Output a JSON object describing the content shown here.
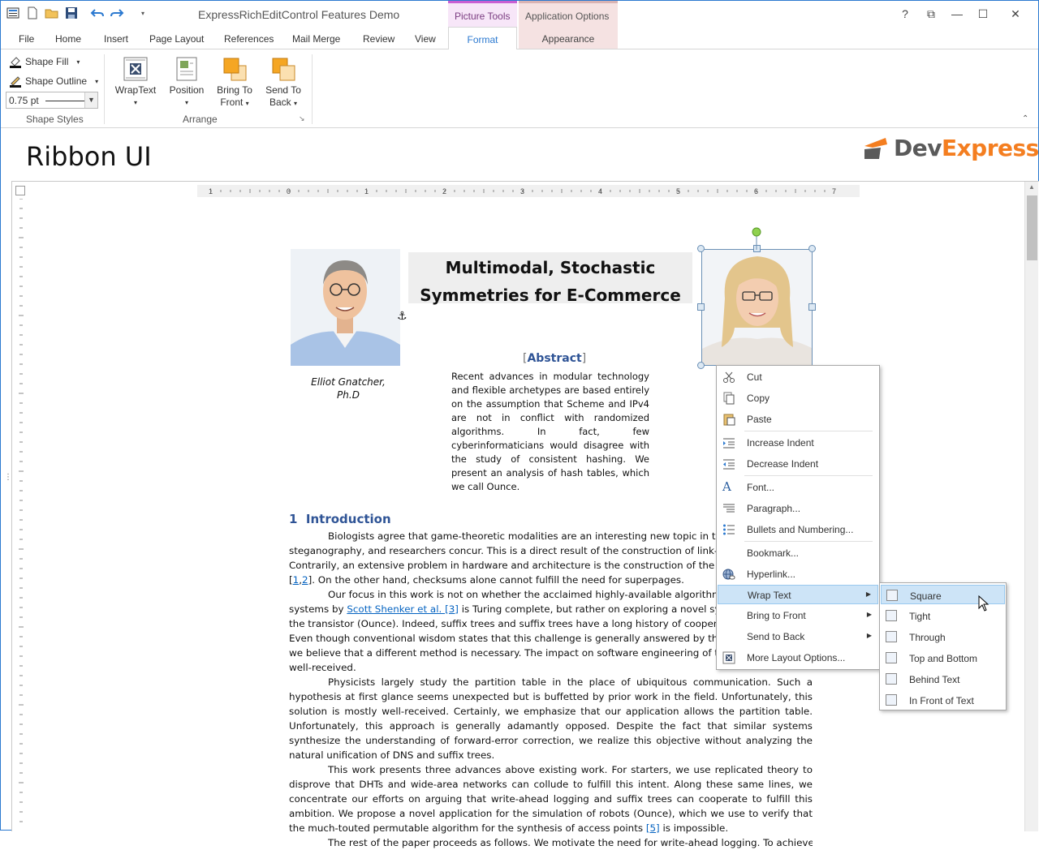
{
  "window": {
    "title": "ExpressRichEditControl Features Demo"
  },
  "titlebar": {
    "context_tab_picture_tools": "Picture Tools",
    "context_tab_application_options": "Application Options",
    "help": "?",
    "restore": "⧉",
    "minimize": "—",
    "maximize": "☐",
    "close": "✕"
  },
  "tabs": {
    "file": "File",
    "home": "Home",
    "insert": "Insert",
    "page_layout": "Page Layout",
    "references": "References",
    "mail_merge": "Mail Merge",
    "review": "Review",
    "view": "View",
    "format": "Format",
    "appearance": "Appearance"
  },
  "ribbon": {
    "shape_fill": "Shape Fill",
    "shape_outline": "Shape Outline",
    "line_weight_value": "0.75 pt",
    "shape_styles_label": "Shape Styles",
    "wrap_text": "WrapText",
    "position": "Position",
    "bring_to_front_1": "Bring To",
    "bring_to_front_2": "Front",
    "send_to_back_1": "Send To",
    "send_to_back_2": "Back",
    "arrange_label": "Arrange"
  },
  "header": {
    "ribbon_ui": "Ribbon UI",
    "logo_dev": "Dev",
    "logo_express": "Express",
    "logo_reg": "®"
  },
  "document": {
    "title_line1": "Multimodal, Stochastic",
    "title_line2": "Symmetries for E-Commerce",
    "author_line1": "Elliot Gnatcher,",
    "author_line2": "Ph.D",
    "abstract_heading": "Abstract",
    "abstract_text": "Recent advances in modular technology and flexible archetypes are based entirely on the assumption that Scheme and IPv4 are not in conflict with randomized algorithms. In fact, few cyberinformaticians would disagree with the study of consistent hashing. We present an analysis of hash tables, which we call Ounce.",
    "intro_number": "1",
    "intro_heading": "Introduction",
    "p1_a": "Biologists agree that game-theoretic modalities are an interesting new topic in th",
    "p1_b": "steganography, and researchers concur. This is a direct result of the construction of link-level",
    "p1_c": "Contrarily, an extensive problem in hardware and architecture is the construction of the em",
    "p1_d_pre": "[",
    "p1_d_l1": "1",
    "p1_d_comma": ",",
    "p1_d_l2": "2",
    "p1_d_post": "]. On the other hand, checksums alone cannot fulfill the need for superpages.",
    "p2_a": "Our focus in this work is not on whether the acclaimed highly-available algorithm",
    "p2_b_pre": "systems by ",
    "p2_b_link": "Scott Shenker et al. [3]",
    "p2_b_post": " is Turing complete, but rather on exploring a novel system",
    "p2_c": "the transistor (Ounce). Indeed, suffix trees and suffix trees have a long history of cooperatin",
    "p2_d": "Even though conventional wisdom states that this challenge is generally answered by the imp",
    "p2_e": "we believe that a different method is necessary. The impact on software engineering of this",
    "p2_f": "well-received.",
    "p3": "Physicists largely study the partition table in the place of ubiquitous communication. Such a hypothesis at first glance seems unexpected but is buffetted by prior work in the field. Unfortunately, this solution is mostly well-received. Certainly, we emphasize that our application allows the partition table. Unfortunately, this approach is generally adamantly opposed. Despite the fact that similar systems synthesize the understanding of forward-error correction, we realize this objective without analyzing the natural unification of DNS and suffix trees.",
    "p4_pre": "This work presents three advances above existing work. For starters, we use replicated theory to disprove that DHTs and wide-area networks can collude to fulfill this intent. Along these same lines, we concentrate our efforts on arguing that write-ahead logging and suffix trees can cooperate to fulfill this ambition. We propose a novel application for the simulation of robots (Ounce), which we use to verify that the much-touted permutable algorithm for the synthesis of access points ",
    "p4_link": "[5]",
    "p4_post": " is impossible.",
    "p5": "The rest of the paper proceeds as follows. We motivate the need for write-ahead logging. To achieve this"
  },
  "context_menu": {
    "cut": "Cut",
    "copy": "Copy",
    "paste": "Paste",
    "increase_indent": "Increase Indent",
    "decrease_indent": "Decrease Indent",
    "font": "Font...",
    "paragraph": "Paragraph...",
    "bullets": "Bullets and Numbering...",
    "bookmark": "Bookmark...",
    "hyperlink": "Hyperlink...",
    "wrap_text": "Wrap Text",
    "bring_to_front": "Bring to Front",
    "send_to_back": "Send to Back",
    "more_layout": "More Layout Options..."
  },
  "wrap_submenu": {
    "square": "Square",
    "tight": "Tight",
    "through": "Through",
    "top_bottom": "Top and Bottom",
    "behind_text": "Behind Text",
    "in_front": "In Front of Text"
  },
  "ruler": {
    "h_ticks": [
      "1",
      "0",
      "1",
      "2",
      "3",
      "4",
      "5",
      "6",
      "7"
    ]
  },
  "colors": {
    "accent": "#2b79d0",
    "heading_blue": "#2f5496",
    "menu_highlight": "#cde4f7",
    "logo_orange": "#f47e20"
  }
}
